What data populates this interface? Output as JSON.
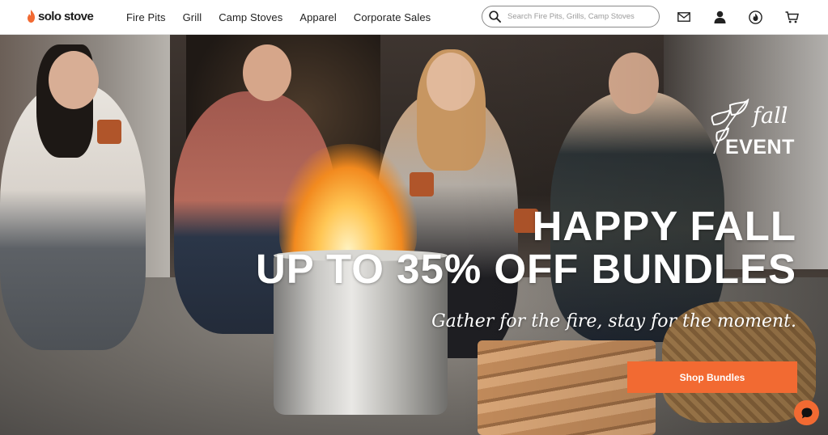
{
  "brand": {
    "name": "solo stove",
    "accent_color": "#f26a32"
  },
  "nav": {
    "items": [
      {
        "label": "Fire Pits"
      },
      {
        "label": "Grill"
      },
      {
        "label": "Camp Stoves"
      },
      {
        "label": "Apparel"
      },
      {
        "label": "Corporate Sales"
      }
    ]
  },
  "search": {
    "placeholder": "Search Fire Pits, Grills, Camp Stoves",
    "value": ""
  },
  "header_icons": [
    "mail-icon",
    "account-icon",
    "flame-icon",
    "cart-icon"
  ],
  "hero": {
    "badge_fall": "fall",
    "badge_event": "EVENT",
    "headline_line1": "HAPPY FALL",
    "headline_line2": "UP TO 35% OFF BUNDLES",
    "tagline": "Gather for the fire, stay for the moment.",
    "cta_label": "Shop Bundles"
  },
  "chat": {
    "icon": "chat-bubble-icon"
  }
}
